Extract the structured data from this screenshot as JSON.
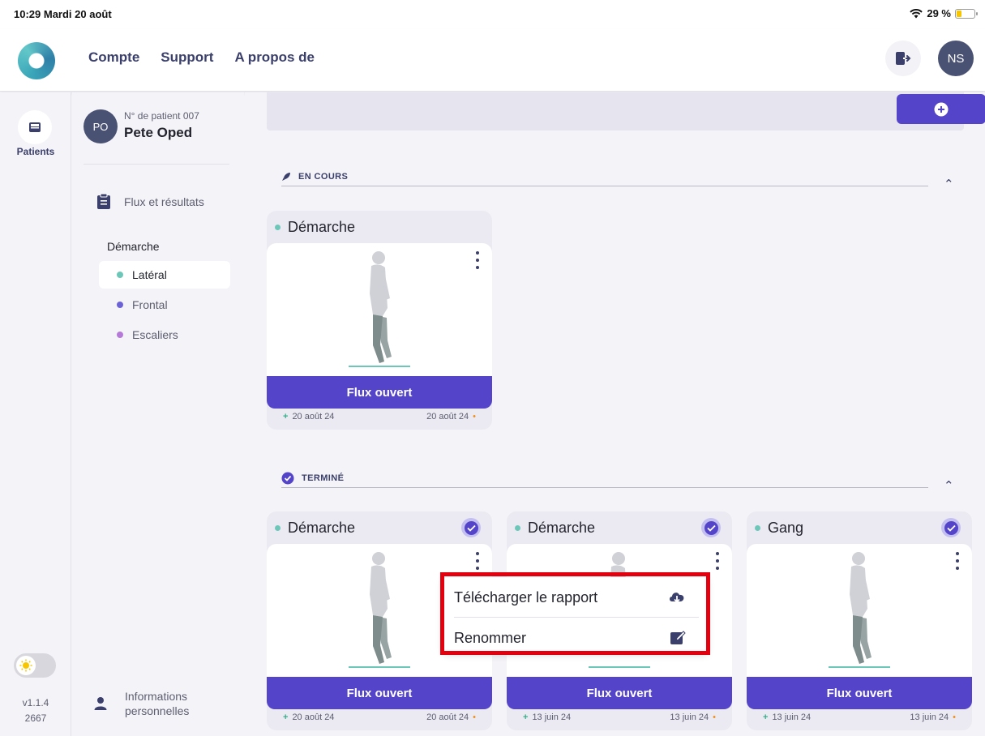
{
  "status_bar": {
    "time_date": "10:29  Mardi 20 août",
    "battery": "29 %",
    "battery_level": 0.29
  },
  "nav": {
    "links": [
      "Compte",
      "Support",
      "A propos de"
    ],
    "user_initials": "NS"
  },
  "rail": {
    "patients_label": "Patients",
    "version": "v1.1.4",
    "build": "2667"
  },
  "patient": {
    "initials": "PO",
    "number": "N° de patient 007",
    "name": "Pete Oped",
    "flux_label": "Flux et résultats",
    "section": "Démarche",
    "items": [
      {
        "label": "Latéral",
        "color": "#6cc7b8"
      },
      {
        "label": "Frontal",
        "color": "#6b62d6"
      },
      {
        "label": "Escaliers",
        "color": "#b57ad8"
      }
    ],
    "info_line1": "Informations",
    "info_line2": "personnelles"
  },
  "sections": {
    "en_cours": "EN COURS",
    "termine": "TERMINÉ"
  },
  "cards_en_cours": [
    {
      "title": "Démarche",
      "button": "Flux ouvert",
      "created": "20 août 24",
      "updated": "20 août 24"
    }
  ],
  "cards_termine": [
    {
      "title": "Démarche",
      "button": "Flux ouvert",
      "created": "20 août 24",
      "updated": "20 août 24"
    },
    {
      "title": "Démarche",
      "button": "Flux ouvert",
      "created": "13 juin 24",
      "updated": "13 juin 24"
    },
    {
      "title": "Gang",
      "button": "Flux ouvert",
      "created": "13 juin 24",
      "updated": "13 juin 24"
    }
  ],
  "menu": {
    "download": "Télécharger le rapport",
    "rename": "Renommer"
  },
  "colors": {
    "accent": "#5444c9",
    "highlight": "#e3000f",
    "teal": "#6cc7b8"
  }
}
